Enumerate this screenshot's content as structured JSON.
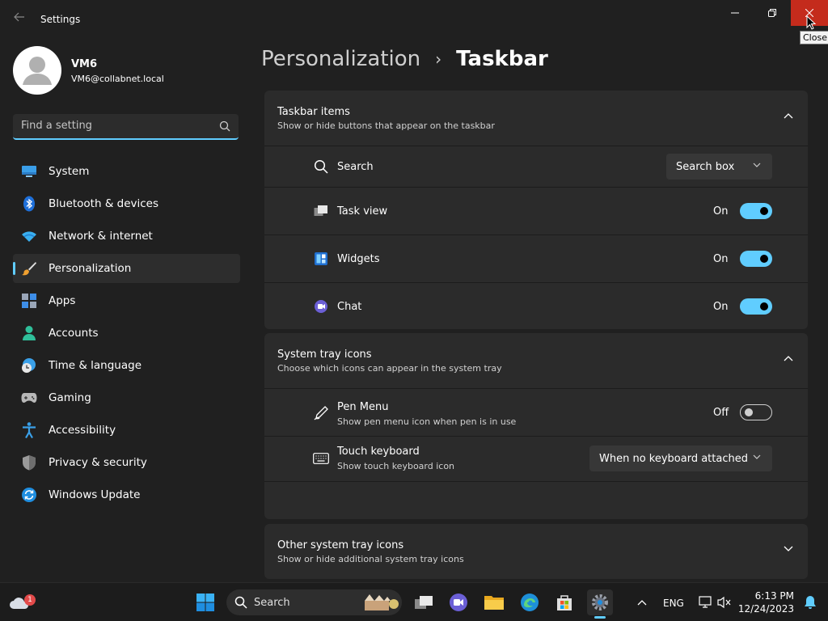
{
  "window": {
    "title": "Settings",
    "close_tooltip": "Close"
  },
  "profile": {
    "name": "VM6",
    "email": "VM6@collabnet.local"
  },
  "search": {
    "placeholder": "Find a setting"
  },
  "sidebar": {
    "items": [
      {
        "label": "System",
        "icon": "system-icon",
        "active": false
      },
      {
        "label": "Bluetooth & devices",
        "icon": "bluetooth-icon",
        "active": false
      },
      {
        "label": "Network & internet",
        "icon": "wifi-icon",
        "active": false
      },
      {
        "label": "Personalization",
        "icon": "brush-icon",
        "active": true
      },
      {
        "label": "Apps",
        "icon": "apps-icon",
        "active": false
      },
      {
        "label": "Accounts",
        "icon": "person-icon",
        "active": false
      },
      {
        "label": "Time & language",
        "icon": "globe-clock-icon",
        "active": false
      },
      {
        "label": "Gaming",
        "icon": "gamepad-icon",
        "active": false
      },
      {
        "label": "Accessibility",
        "icon": "accessibility-icon",
        "active": false
      },
      {
        "label": "Privacy & security",
        "icon": "shield-icon",
        "active": false
      },
      {
        "label": "Windows Update",
        "icon": "update-icon",
        "active": false
      }
    ]
  },
  "breadcrumb": {
    "parent": "Personalization",
    "separator": "›",
    "current": "Taskbar"
  },
  "taskbar_items": {
    "title": "Taskbar items",
    "subtitle": "Show or hide buttons that appear on the taskbar",
    "search": {
      "label": "Search",
      "value": "Search box"
    },
    "task_view": {
      "label": "Task view",
      "state": "On"
    },
    "widgets": {
      "label": "Widgets",
      "state": "On"
    },
    "chat": {
      "label": "Chat",
      "state": "On"
    }
  },
  "system_tray": {
    "title": "System tray icons",
    "subtitle": "Choose which icons can appear in the system tray",
    "pen_menu": {
      "label": "Pen Menu",
      "sub": "Show pen menu icon when pen is in use",
      "state": "Off"
    },
    "touch_keyboard": {
      "label": "Touch keyboard",
      "sub": "Show touch keyboard icon",
      "value": "When no keyboard attached"
    }
  },
  "other_tray": {
    "title": "Other system tray icons",
    "subtitle": "Show or hide additional system tray icons"
  },
  "taskbar": {
    "search_label": "Search",
    "weather_badge": "1",
    "language": "ENG",
    "time": "6:13 PM",
    "date": "12/24/2023"
  },
  "colors": {
    "accent": "#60cdff",
    "close_red": "#c42b1c",
    "background": "#202020",
    "card": "#2b2b2b"
  }
}
